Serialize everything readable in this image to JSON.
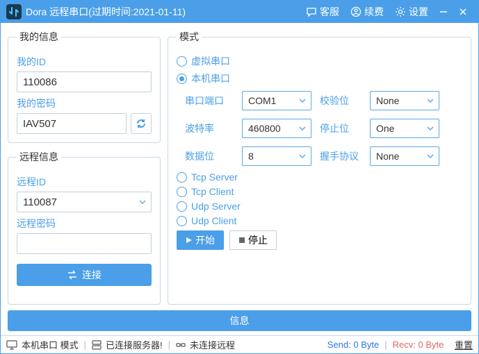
{
  "titlebar": {
    "title": "Dora 远程串口(过期时间:2021-01-11)",
    "support_label": "客服",
    "renew_label": "续费",
    "settings_label": "设置"
  },
  "myinfo": {
    "legend": "我的信息",
    "id_label": "我的ID",
    "id_value": "110086",
    "pwd_label": "我的密码",
    "pwd_value": "IAV507"
  },
  "remote": {
    "legend": "远程信息",
    "id_label": "远程ID",
    "id_value": "110087",
    "pwd_label": "远程密码",
    "pwd_value": "",
    "connect_label": "连接"
  },
  "mode": {
    "legend": "模式",
    "options": {
      "virtual": "虚拟串口",
      "local": "本机串口",
      "tcp_server": "Tcp Server",
      "tcp_client": "Tcp Client",
      "udp_server": "Udp Server",
      "udp_client": "Udp Client"
    },
    "labels": {
      "port": "串口端口",
      "baud": "波特率",
      "databits": "数据位",
      "parity": "校验位",
      "stopbits": "停止位",
      "handshake": "握手协议"
    },
    "values": {
      "port": "COM1",
      "baud": "460800",
      "databits": "8",
      "parity": "None",
      "stopbits": "One",
      "handshake": "None"
    },
    "start_label": "开始",
    "stop_label": "停止"
  },
  "info_button": "信息",
  "status": {
    "mode": "本机串口 模式",
    "server": "已连接服务器!",
    "remote": "未连接远程",
    "send_label": "Send:",
    "send_value": "0 Byte",
    "recv_label": "Recv:",
    "recv_value": "0 Byte",
    "reset": "重置"
  }
}
